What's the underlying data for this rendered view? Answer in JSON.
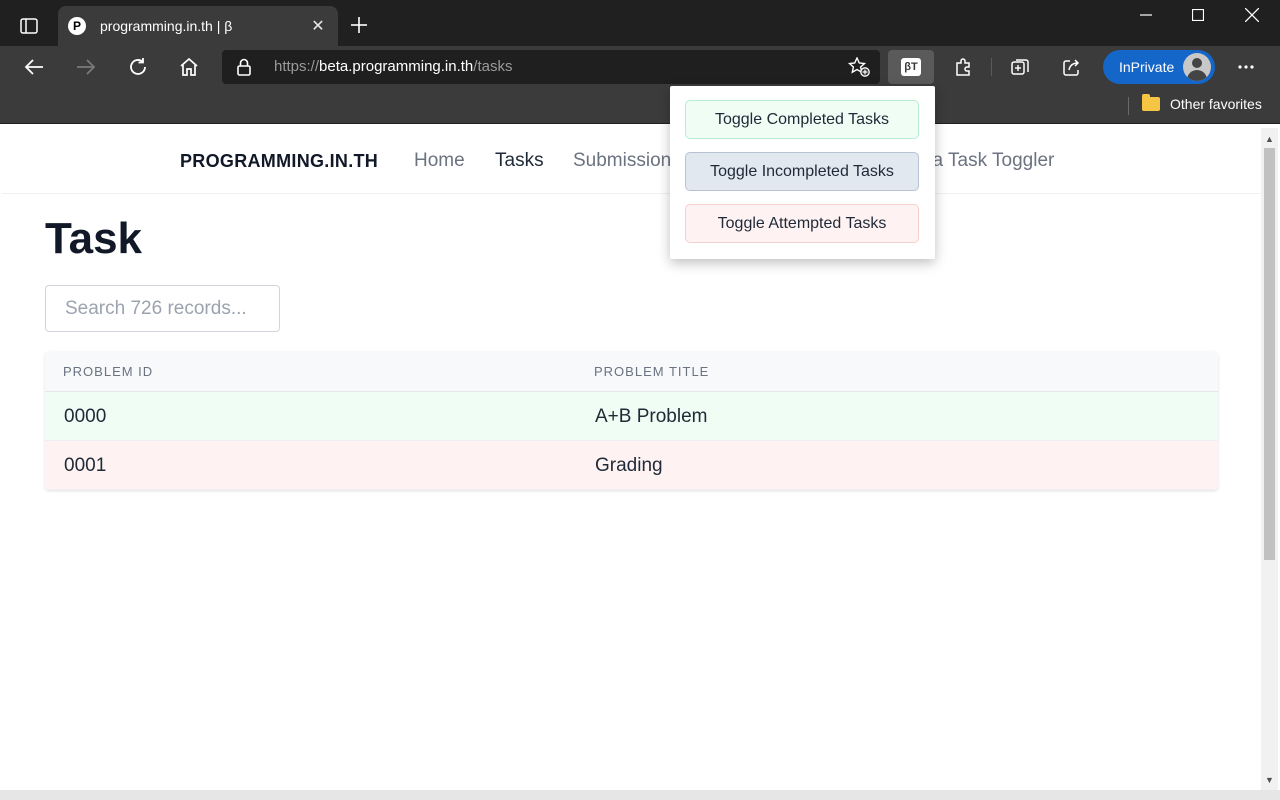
{
  "browser": {
    "tab_title": "programming.in.th | β",
    "favicon_letter": "P",
    "url_scheme": "https://",
    "url_host": "beta.programming.in.th",
    "url_path": "/tasks",
    "extension_badge": "βT",
    "profile_label": "InPrivate",
    "favorites_label": "Other favorites"
  },
  "nav": {
    "brand": "PROGRAMMING.IN.TH",
    "links": [
      "Home",
      "Tasks",
      "Submission",
      "Beta Task Toggler"
    ],
    "active": "Tasks"
  },
  "main": {
    "title": "Task",
    "search_placeholder": "Search 726 records..."
  },
  "table": {
    "columns": [
      "PROBLEM ID",
      "PROBLEM TITLE"
    ],
    "rows": [
      {
        "id": "0000",
        "title": "A+B Problem",
        "status": "completed"
      },
      {
        "id": "0001",
        "title": "Grading",
        "status": "attempted"
      }
    ]
  },
  "popup": {
    "buttons": [
      {
        "label": "Toggle Completed Tasks"
      },
      {
        "label": "Toggle Incompleted Tasks"
      },
      {
        "label": "Toggle Attempted Tasks"
      }
    ]
  },
  "colors": {
    "completed_row": "#effdf4",
    "attempted_row": "#fef3f2",
    "incompleted_button": "#e2e8f0",
    "inprivate_accent": "#1466c8"
  },
  "icons": [
    "tab-actions-icon",
    "close-icon",
    "plus-icon",
    "minimize-icon",
    "maximize-icon",
    "window-close-icon",
    "back-icon",
    "forward-icon",
    "refresh-icon",
    "home-icon",
    "lock-icon",
    "add-favorite-icon",
    "extensions-icon",
    "collections-icon",
    "share-icon",
    "more-icon",
    "folder-icon"
  ]
}
